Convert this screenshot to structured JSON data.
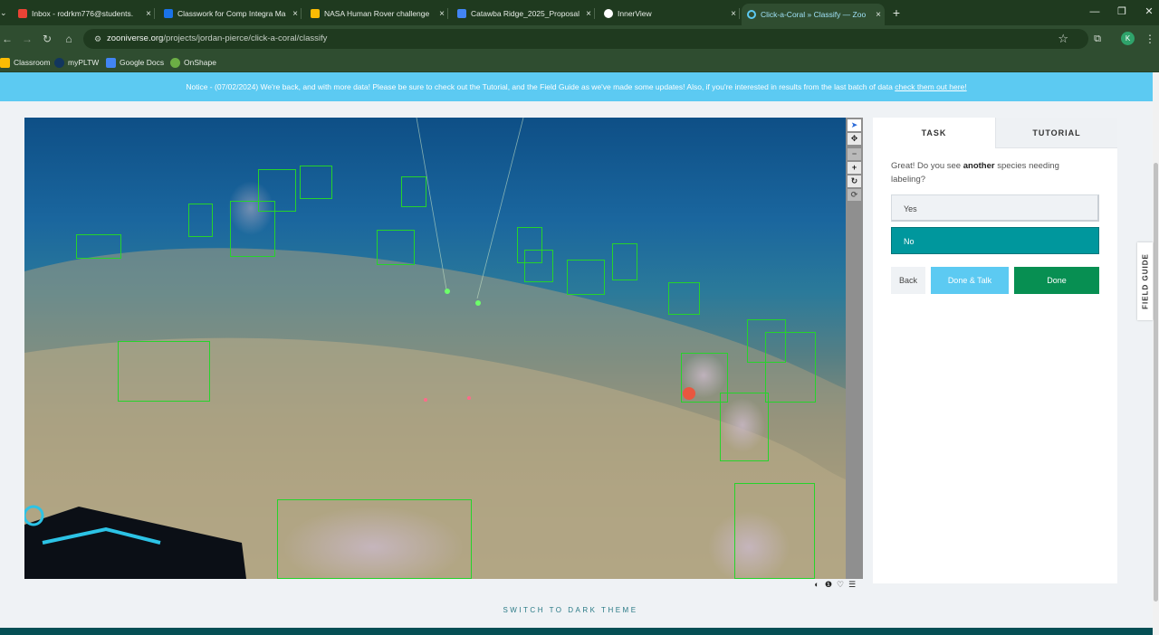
{
  "browser": {
    "tabs": [
      {
        "title": "Inbox - rodrkm776@students.",
        "favicon_color": "#ea4335",
        "active": false
      },
      {
        "title": "Classwork for Comp Integra Ma",
        "favicon_color": "#1a73e8",
        "active": false
      },
      {
        "title": "NASA Human Rover challenge",
        "favicon_color": "#fbbc04",
        "active": false
      },
      {
        "title": "Catawba Ridge_2025_Proposal",
        "favicon_color": "#4285f4",
        "active": false
      },
      {
        "title": "InnerView",
        "favicon_color": "#ffffff",
        "active": false
      },
      {
        "title": "Click-a-Coral » Classify — Zoo",
        "favicon_color": "#5ccaf2",
        "active": true
      }
    ],
    "tab_close_glyph": "×",
    "new_tab_glyph": "+",
    "url_domain": "zooniverse.org",
    "url_path": "/projects/jordan-pierce/click-a-coral/classify",
    "profile_initial": "K",
    "bookmarks": [
      {
        "label": "Classroom",
        "icon_color": "#fbbc04"
      },
      {
        "label": "myPLTW",
        "icon_color": "#12365e"
      },
      {
        "label": "Google Docs",
        "icon_color": "#4285f4"
      },
      {
        "label": "OnShape",
        "icon_color": "#6cae45"
      }
    ],
    "chrome_color": "#2f4d30"
  },
  "notice": {
    "text": "Notice - (07/02/2024) We're back, and with more data! Please be sure to check out the Tutorial, and the Field Guide as we've made some updates! Also, if you're interested in results from the last batch of data",
    "link": "check them out here!"
  },
  "task": {
    "tabs": {
      "task": "TASK",
      "tutorial": "TUTORIAL"
    },
    "question_prefix": "Great! Do you see ",
    "question_bold": "another",
    "question_suffix": " species needing labeling?",
    "answers": {
      "yes": "Yes",
      "no": "No"
    },
    "selected_answer": "No",
    "buttons": {
      "back": "Back",
      "done_talk": "Done & Talk",
      "done": "Done"
    }
  },
  "field_guide": "FIELD GUIDE",
  "theme_toggle": "SWITCH TO DARK THEME",
  "colors": {
    "notice_bg": "#5ccaf2",
    "selected_answer": "#00979d",
    "done": "#078f52",
    "done_talk": "#5ccaf2",
    "annotation_box": "#26d32b"
  }
}
